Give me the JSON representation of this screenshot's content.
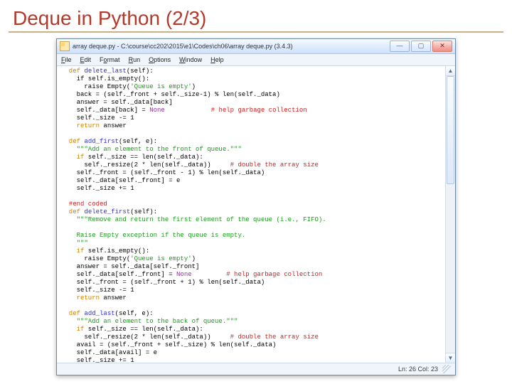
{
  "slide": {
    "title": "Deque in Python (2/3)"
  },
  "window": {
    "title": "array deque.py - C:\\course\\cc202\\2015\\e1\\Codes\\ch06\\array deque.py (3.4.3)",
    "min": "—",
    "max": "▢",
    "close": "✕"
  },
  "menu": {
    "file": "File",
    "edit": "Edit",
    "format": "Format",
    "run": "Run",
    "options": "Options",
    "window": "Window",
    "help": "Help"
  },
  "status": {
    "pos": "Ln: 26 Col: 23"
  },
  "code": {
    "t01a": "  def",
    "t01b": " delete_last",
    "t01c": "(self):",
    "t02": "    if self.is_empty():",
    "t03a": "      raise Empty(",
    "t03b": "'Queue is empty'",
    "t03c": ")",
    "t04": "    back = (self._front + self._size-1) % len(self._data)",
    "t05": "    answer = self._data[back]",
    "t06a": "    self._data[back] = ",
    "t06b": "None",
    "t06c": "            ",
    "t06d": "# help garbage collection",
    "t07": "    self._size -= 1",
    "t08a": "    return",
    "t08b": " answer",
    "t09": "",
    "t10a": "  def",
    "t10b": " add_first",
    "t10c": "(self, e):",
    "t11": "    \"\"\"Add an element to the front of queue.\"\"\"",
    "t12a": "    if",
    "t12b": " self._size == len(self._data):",
    "t13a": "      self._resize(2 * len(self._data))     ",
    "t13b": "# double the array size",
    "t14": "    self._front = (self._front - 1) % len(self._data)",
    "t15": "    self._data[self._front] = e",
    "t16": "    self._size += 1",
    "t17": "",
    "t18": "  #end coded",
    "t19a": "  def",
    "t19b": " delete_first",
    "t19c": "(self):",
    "t20": "    \"\"\"Remove and return the first element of the queue (i.e., FIFO).",
    "t21": "",
    "t22": "    Raise Empty exception if the queue is empty.",
    "t23": "    \"\"\"",
    "t24a": "    if",
    "t24b": " self.is_empty():",
    "t25a": "      raise Empty(",
    "t25b": "'Queue is empty'",
    "t25c": ")",
    "t26": "    answer = self._data[self._front]",
    "t27a": "    self._data[self._front] = ",
    "t27b": "None",
    "t27c": "         ",
    "t27d": "# help garbage collection",
    "t28": "    self._front = (self._front + 1) % len(self._data)",
    "t29": "    self._size -= 1",
    "t30a": "    return",
    "t30b": " answer",
    "t31": "",
    "t32a": "  def",
    "t32b": " add_last",
    "t32c": "(self, e):",
    "t33": "    \"\"\"Add an element to the back of queue.\"\"\"",
    "t34a": "    if",
    "t34b": " self._size == len(self._data):",
    "t35a": "      self._resize(2 * len(self._data))     ",
    "t35b": "# double the array size",
    "t36": "    avail = (self._front + self._size) % len(self._data)",
    "t37": "    self._data[avail] = e",
    "t38": "    self._size += 1"
  }
}
